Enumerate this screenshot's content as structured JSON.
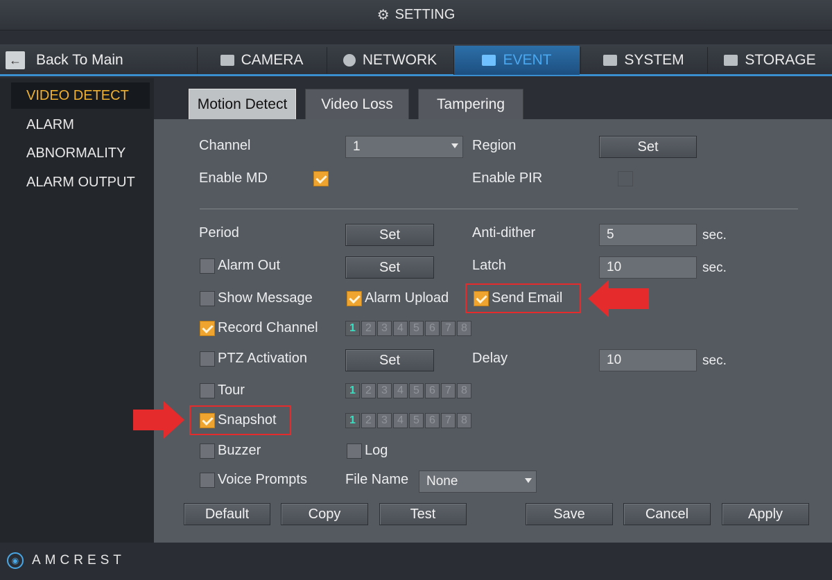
{
  "title": "SETTING",
  "nav": {
    "back_label": "Back To Main",
    "tabs": [
      {
        "label": "CAMERA",
        "icon": "camera-icon"
      },
      {
        "label": "NETWORK",
        "icon": "globe-icon"
      },
      {
        "label": "EVENT",
        "icon": "event-icon",
        "active": true
      },
      {
        "label": "SYSTEM",
        "icon": "system-icon"
      },
      {
        "label": "STORAGE",
        "icon": "storage-icon"
      }
    ]
  },
  "sidebar": {
    "items": [
      {
        "label": "VIDEO DETECT",
        "active": true
      },
      {
        "label": "ALARM"
      },
      {
        "label": "ABNORMALITY"
      },
      {
        "label": "ALARM OUTPUT"
      }
    ]
  },
  "subtabs": [
    {
      "label": "Motion Detect",
      "active": true
    },
    {
      "label": "Video Loss"
    },
    {
      "label": "Tampering"
    }
  ],
  "form": {
    "channel_label": "Channel",
    "channel_value": "1",
    "region_label": "Region",
    "set_label": "Set",
    "enable_md_label": "Enable MD",
    "enable_md_checked": true,
    "enable_pir_label": "Enable PIR",
    "enable_pir_checked": false,
    "period_label": "Period",
    "anti_dither_label": "Anti-dither",
    "anti_dither_value": "5",
    "sec": "sec.",
    "alarm_out_label": "Alarm Out",
    "latch_label": "Latch",
    "latch_value": "10",
    "show_message_label": "Show Message",
    "alarm_upload_label": "Alarm Upload",
    "send_email_label": "Send Email",
    "record_channel_label": "Record Channel",
    "ptz_activation_label": "PTZ Activation",
    "delay_label": "Delay",
    "delay_value": "10",
    "tour_label": "Tour",
    "snapshot_label": "Snapshot",
    "buzzer_label": "Buzzer",
    "log_label": "Log",
    "voice_prompts_label": "Voice Prompts",
    "file_name_label": "File Name",
    "file_name_value": "None",
    "channels": [
      "1",
      "2",
      "3",
      "4",
      "5",
      "6",
      "7",
      "8"
    ]
  },
  "actions": {
    "default": "Default",
    "copy": "Copy",
    "test": "Test",
    "save": "Save",
    "cancel": "Cancel",
    "apply": "Apply"
  },
  "brand": "AMCREST",
  "colors": {
    "accent": "#3a8fd0",
    "checkbox_on": "#f0a430",
    "sidebar_active_text": "#f0b030",
    "annotation_red": "#e52b2b",
    "channel_selected": "#36e0c0"
  }
}
